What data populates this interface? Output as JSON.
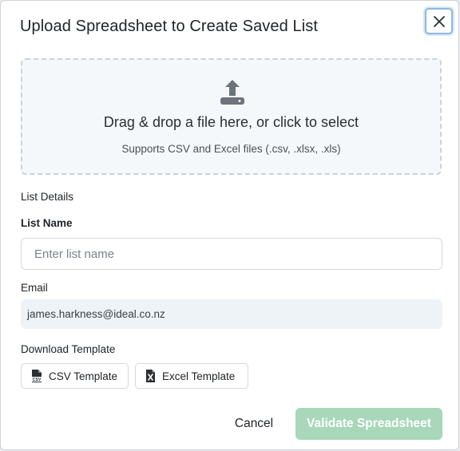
{
  "dialog": {
    "title": "Upload Spreadsheet to Create Saved List",
    "close_icon": "close-icon"
  },
  "dropzone": {
    "icon": "upload-icon",
    "main_text": "Drag & drop a file here, or click to select",
    "sub_text": "Supports CSV and Excel files (.csv, .xlsx, .xls)"
  },
  "list_details": {
    "section_label": "List Details",
    "name_label": "List Name",
    "name_placeholder": "Enter list name",
    "name_value": "",
    "email_label": "Email",
    "email_value": "james.harkness@ideal.co.nz"
  },
  "templates": {
    "section_label": "Download Template",
    "csv_label": "CSV Template",
    "csv_icon": "csv-file-icon",
    "excel_label": "Excel Template",
    "excel_icon": "excel-file-icon"
  },
  "footer": {
    "cancel_label": "Cancel",
    "validate_label": "Validate Spreadsheet"
  },
  "colors": {
    "validate_disabled_bg": "#a8d7b9",
    "close_focus_ring": "#8fb8e0",
    "dropzone_bg": "#f5f8fb"
  }
}
